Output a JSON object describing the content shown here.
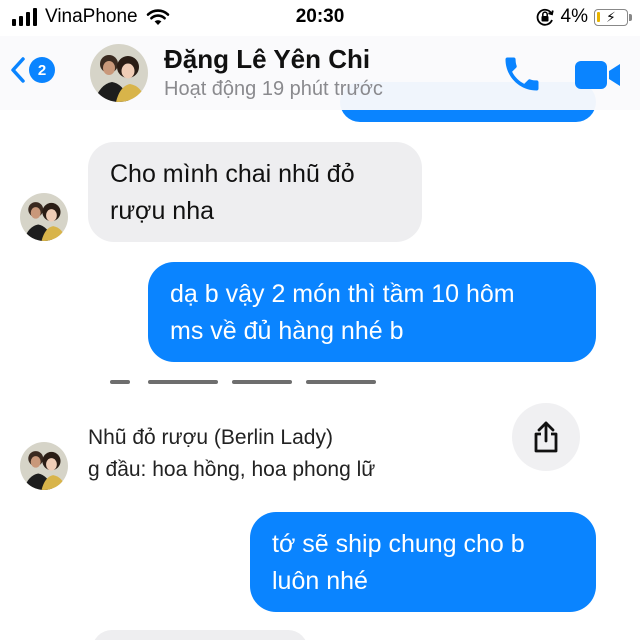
{
  "status_bar": {
    "carrier": "VinaPhone",
    "time": "20:30",
    "battery_percent": "4%",
    "battery_level": 0.04
  },
  "header": {
    "back_badge_count": "2",
    "contact_name": "Đặng Lê Yên Chi",
    "contact_status": "Hoạt động 19 phút trước",
    "icons": [
      "chevron-left-icon",
      "phone-icon",
      "video-camera-icon"
    ]
  },
  "messages": [
    {
      "direction": "incoming",
      "lines": [
        "Cho mình chai nhũ đỏ",
        "rượu nha"
      ]
    },
    {
      "direction": "outgoing",
      "lines": [
        "dạ b vậy 2 món thì tầm 10 hôm",
        "ms về đủ hàng nhé b"
      ]
    },
    {
      "direction": "incoming",
      "type": "shared",
      "lines": [
        "Nhũ đỏ rượu (Berlin Lady)",
        "g đầu: hoa hồng, hoa phong lữ"
      ]
    },
    {
      "direction": "outgoing",
      "lines": [
        "tớ sẽ ship chung cho b",
        "luôn nhé"
      ]
    }
  ],
  "colors": {
    "accent": "#0a84ff",
    "incoming_bubble": "#eeeef0",
    "secondary_text": "#8a8a8e"
  }
}
